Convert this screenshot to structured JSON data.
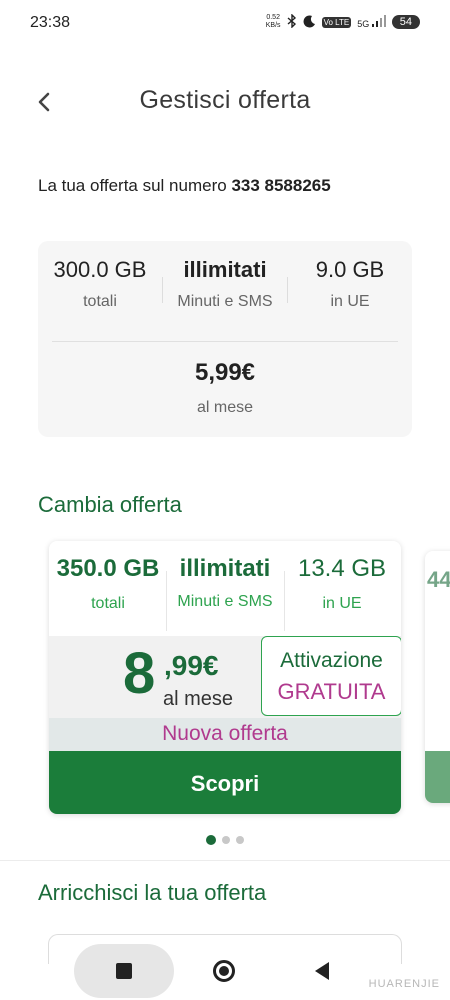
{
  "status_bar": {
    "time": "23:38",
    "net_speed_value": "0.52",
    "net_speed_unit": "KB/s",
    "volte": "Vo LTE",
    "network": "5G",
    "battery": "54"
  },
  "header": {
    "title": "Gestisci offerta"
  },
  "offer_intro": {
    "label": "La tua offerta sul numero",
    "number": "333 8588265"
  },
  "current_offer": {
    "data": {
      "value": "300.0 GB",
      "label": "totali"
    },
    "minutes": {
      "value": "illimitati",
      "label": "Minuti e SMS"
    },
    "eu": {
      "value": "9.0 GB",
      "label": "in UE"
    },
    "price": "5,99€",
    "price_label": "al mese"
  },
  "change_offer": {
    "title": "Cambia offerta",
    "card": {
      "data": {
        "value": "350.0 GB",
        "label": "totali"
      },
      "minutes": {
        "value": "illimitati",
        "label": "Minuti e SMS"
      },
      "eu": {
        "value": "13.4 GB",
        "label": "in UE"
      },
      "price_int": "8",
      "price_dec": ",99€",
      "price_label": "al mese",
      "activation_line1": "Attivazione",
      "activation_line2": "GRATUITA",
      "new_offer": "Nuova offerta",
      "button": "Scopri"
    },
    "peek_value": "44",
    "pagination": {
      "total": 3,
      "active": 0
    }
  },
  "enrich": {
    "title": "Arricchisci la tua offerta"
  },
  "watermark": "HUARENJIE",
  "colors": {
    "brand_green": "#1b6b3a",
    "button_green": "#1b7d3a",
    "accent_magenta": "#b03a8e"
  }
}
